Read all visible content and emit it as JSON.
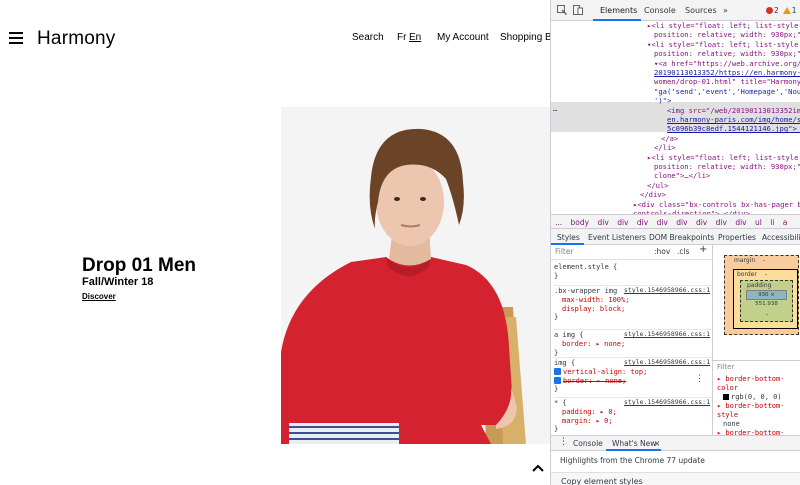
{
  "site": {
    "brand": "Harmony",
    "nav": {
      "search": "Search",
      "lang_fr": "Fr",
      "lang_en": "En",
      "account": "My Account",
      "bag": "Shopping Bag"
    },
    "hero": {
      "title": "Drop 01 Men",
      "subtitle": "Fall/Winter 18",
      "cta": "Discover"
    },
    "colors": {
      "sweater": "#d4232e",
      "background": "#ffffff"
    }
  },
  "devtools": {
    "tabs": {
      "elements": "Elements",
      "console": "Console",
      "sources": "Sources",
      "more": "»"
    },
    "errors": "2",
    "warnings": "1",
    "code_lines": [
      "▸<li style=\"float: left; list-style: no",
      "position: relative; width: 930px;\">…</li>",
      "▾<li style=\"float: left; list-style: no",
      "position: relative; width: 930px;\">",
      "▾<a href=\"https://web.archive.org/web",
      "20190113013352/https://en.harmony-pari",
      "women/drop-01.html\" title=\"Harmony\" o",
      "\"ga('send','event','Homepage','Nouvea",
      "')\">",
      "<img src=\"/web/20190113013352im_/h",
      "en.harmony-paris.com/img/home/slic",
      "5c096b39c8edf.1544121146.jpg\"> ==",
      "</a>",
      "</li>",
      "▸<li style=\"float: left; list-style: no",
      "position: relative; width: 930px;\" clas",
      "clone\">…</li>",
      "</ul>",
      "</div>",
      "▸<div class=\"bx-controls bx-has-pager bx-h",
      "controls-direction\">…</div>"
    ],
    "breadcrumbs": [
      "...",
      "body",
      "div",
      "div",
      "div",
      "div",
      "div",
      "div",
      "div",
      "div",
      "ul",
      "li",
      "a"
    ],
    "panel_tabs": {
      "styles": "Styles",
      "listeners": "Event Listeners",
      "dom_bp": "DOM Breakpoints",
      "props": "Properties",
      "access": "Accessibility"
    },
    "filter_placeholder": "Filter",
    "hov": ":hov",
    "cls": ".cls",
    "rules": [
      {
        "selector": "element.style {",
        "source": "",
        "props": [],
        "close": "}"
      },
      {
        "selector": ".bx-wrapper img",
        "source": "style.1546958966.css:1",
        "props": [
          "max-width: 100%;",
          "display: block;"
        ],
        "close": "}"
      },
      {
        "selector": "a img {",
        "source": "style.1546958966.css:1",
        "props": [
          "border: ▸ none;"
        ],
        "close": "}"
      },
      {
        "selector": "img {",
        "source": "style.1546958966.css:1",
        "props": [
          "vertical-align: top;",
          "border: ▸ none;"
        ],
        "close": "}"
      },
      {
        "selector": "* {",
        "source": "style.1546958966.css:1",
        "props": [
          "padding: ▸ 0;",
          "margin: ▸ 0;"
        ],
        "close": "}"
      }
    ],
    "boxmodel": {
      "margin": "margin",
      "border": "border",
      "padding": "padding",
      "content": "930 × 551.938",
      "dash": "-"
    },
    "computed": {
      "filter": "Filter",
      "items": [
        {
          "name": "▸ border-bottom-color",
          "value": "rgb(0, 0, 0)"
        },
        {
          "name": "▸ border-bottom-style",
          "value": "none"
        },
        {
          "name": "▸ border-bottom-width",
          "value": "0px"
        }
      ]
    },
    "drawer": {
      "console": "Console",
      "whatsnew": "What's New",
      "close": "×",
      "message": "Highlights from the Chrome 77 update",
      "card": "Copy element styles"
    }
  }
}
